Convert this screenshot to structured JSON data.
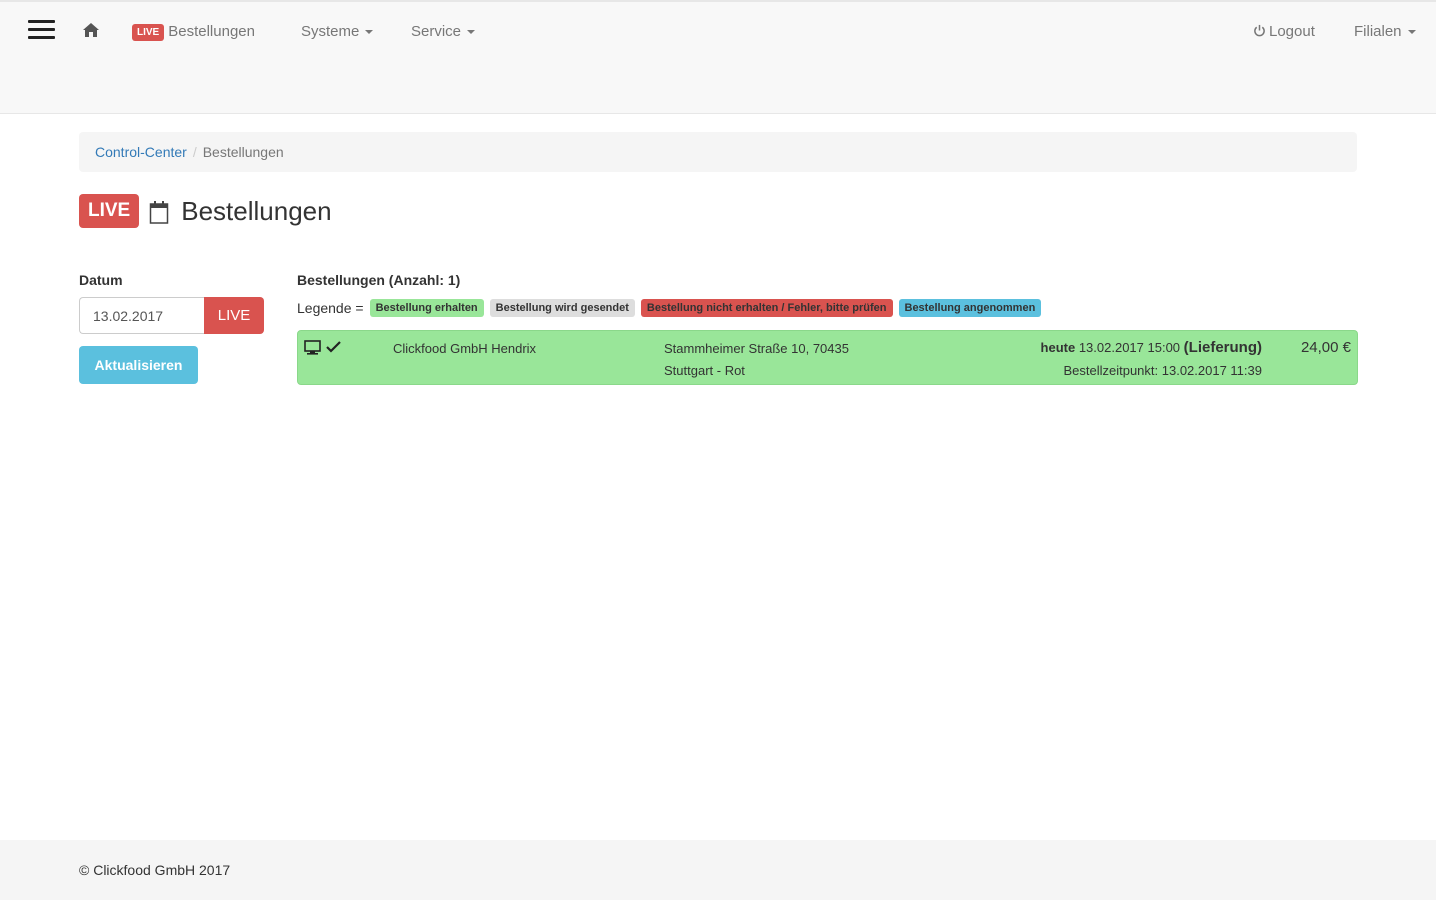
{
  "navbar": {
    "home_icon": "home-icon",
    "live_badge": "LIVE",
    "orders_label": "Bestellungen",
    "systems_label": "Systeme",
    "service_label": "Service",
    "logout_label": "Logout",
    "branches_label": "Filialen"
  },
  "breadcrumb": {
    "root": "Control-Center",
    "current": "Bestellungen"
  },
  "page": {
    "live_badge": "LIVE",
    "title": "Bestellungen"
  },
  "filter": {
    "date_label": "Datum",
    "date_value": "13.02.2017",
    "live_button": "LIVE",
    "refresh_button": "Aktualisieren"
  },
  "orders": {
    "heading": "Bestellungen (Anzahl: 1)",
    "legend_label": "Legende =",
    "legend": [
      {
        "label": "Bestellung erhalten",
        "color": "#99e699"
      },
      {
        "label": "Bestellung wird gesendet",
        "color": "#dddddd"
      },
      {
        "label": "Bestellung nicht erhalten / Fehler, bitte prüfen",
        "color": "#d9534f"
      },
      {
        "label": "Bestellung angenommen",
        "color": "#5bc0de"
      }
    ],
    "rows": [
      {
        "status_color": "#99e699",
        "customer": "Clickfood GmbH Hendrix",
        "street": "Stammheimer Straße 10, 70435",
        "city": "Stuttgart - Rot",
        "delivery_day": "heute",
        "delivery_time": "13.02.2017 15:00",
        "delivery_type": "(Lieferung)",
        "order_time": "Bestellzeitpunkt: 13.02.2017 11:39",
        "amount": "24,00 €"
      }
    ]
  },
  "footer": {
    "copyright": "© Clickfood GmbH 2017"
  }
}
